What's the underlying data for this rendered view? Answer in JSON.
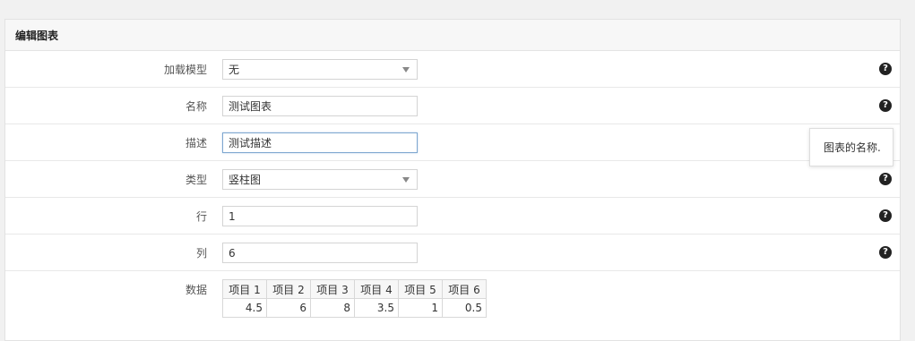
{
  "panel": {
    "title": "编辑图表"
  },
  "form": {
    "model": {
      "label": "加载模型",
      "value": "无"
    },
    "name": {
      "label": "名称",
      "value": "测试图表"
    },
    "description": {
      "label": "描述",
      "value": "测试描述"
    },
    "type": {
      "label": "类型",
      "value": "竖柱图"
    },
    "rows": {
      "label": "行",
      "value": "1"
    },
    "columns": {
      "label": "列",
      "value": "6"
    },
    "data": {
      "label": "数据",
      "headers": [
        "项目 1",
        "项目 2",
        "项目 3",
        "项目 4",
        "项目 5",
        "项目 6"
      ],
      "values": [
        "4.5",
        "6",
        "8",
        "3.5",
        "1",
        "0.5"
      ]
    }
  },
  "help_icon": "question-circle-icon",
  "help_glyph": "?",
  "tooltip": {
    "text": "图表的名称."
  }
}
